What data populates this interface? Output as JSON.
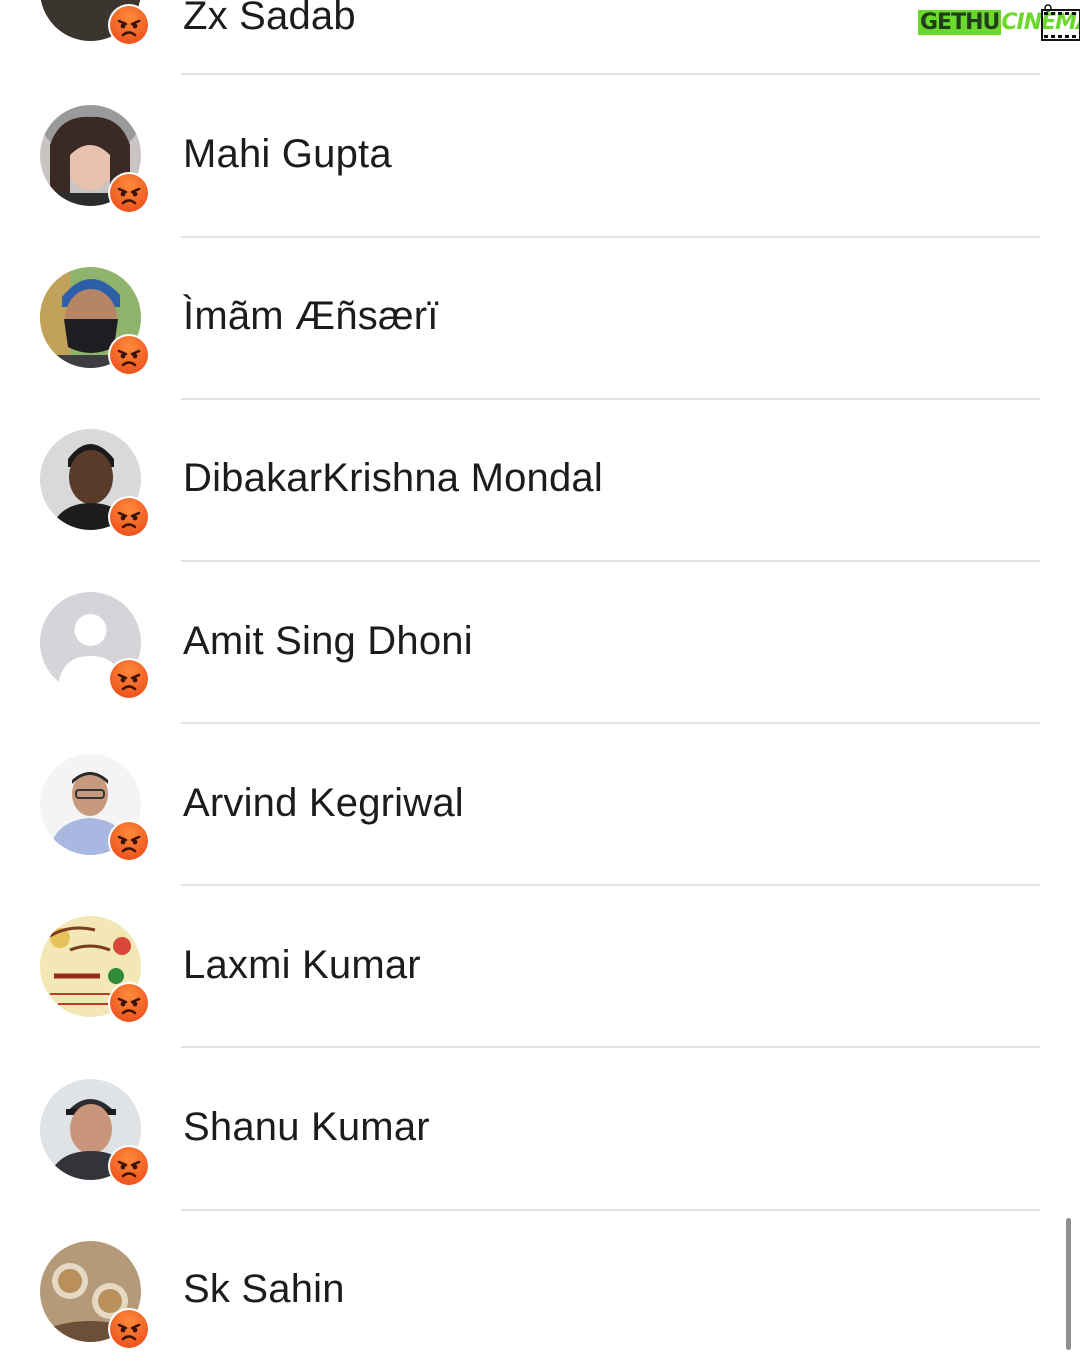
{
  "watermark": {
    "part1": "GETHU",
    "part2": "CINEMA"
  },
  "reaction_icon": "angry-reaction-icon",
  "reaction_color": "#f05a22",
  "contacts": [
    {
      "name": "Zx Sadab"
    },
    {
      "name": "Mahi Gupta"
    },
    {
      "name": "Ìmãm Æñsærï"
    },
    {
      "name": "DibakarKrishna Mondal"
    },
    {
      "name": "Amit Sing Dhoni"
    },
    {
      "name": "Arvind Kegriwal"
    },
    {
      "name": "Laxmi Kumar"
    },
    {
      "name": "Shanu Kumar"
    },
    {
      "name": "Sk Sahin"
    }
  ]
}
